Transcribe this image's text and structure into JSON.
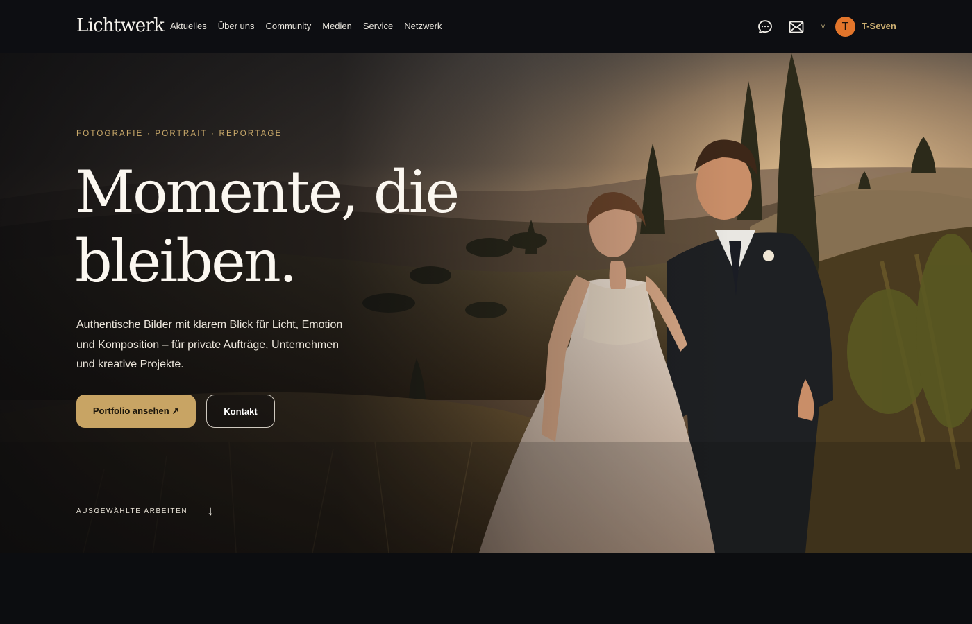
{
  "header": {
    "logo": "Lichtwerk",
    "nav": [
      {
        "label": "Aktuelles"
      },
      {
        "label": "Über uns"
      },
      {
        "label": "Community"
      },
      {
        "label": "Medien"
      },
      {
        "label": "Service"
      },
      {
        "label": "Netzwerk"
      }
    ],
    "icons": {
      "chat": "chat-bubble-icon",
      "mail": "mail-icon"
    },
    "caret": "v",
    "user": {
      "avatar_initial": "T",
      "name": "T-Seven"
    }
  },
  "hero": {
    "eyebrow": "FOTOGRAFIE · PORTRAIT · REPORTAGE",
    "headline_line1": "Momente, die",
    "headline_line2": "bleiben.",
    "lead": "Authentische Bilder mit klarem Blick für Licht, Emotion und Komposition – für private Aufträge, Unternehmen und kreative Projekte.",
    "primary_button": "Portfolio ansehen ↗",
    "secondary_button": "Kontakt",
    "scroll_label": "AUSGEWÄHLTE ARBEITEN",
    "scroll_arrow": "↓",
    "image": "wedding-couple-vineyard-sunset-photo"
  },
  "colors": {
    "background": "#0c0d10",
    "accent": "#c8a464",
    "avatar": "#e2752b",
    "username": "#cfb173"
  }
}
